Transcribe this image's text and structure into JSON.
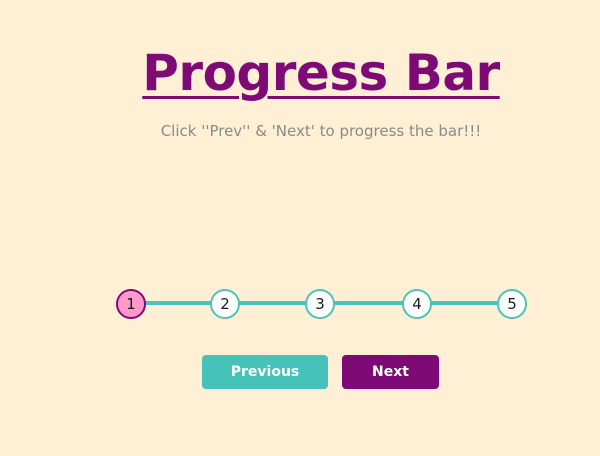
{
  "header": {
    "title": "Progress Bar",
    "subtitle": "Click ''Prev'' & 'Next' to progress the bar!!!"
  },
  "stepper": {
    "steps": [
      "1",
      "2",
      "3",
      "4",
      "5"
    ],
    "active_step": 1,
    "colors": {
      "track": "#4BC3BC",
      "active_fill": "#FF99CC",
      "active_border": "#7E0A76"
    }
  },
  "controls": {
    "previous_label": "Previous",
    "next_label": "Next"
  },
  "colors": {
    "background": "#FFF0D5",
    "title": "#7E0A76",
    "previous_button": "#45C3B8",
    "next_button": "#7E0A76"
  }
}
